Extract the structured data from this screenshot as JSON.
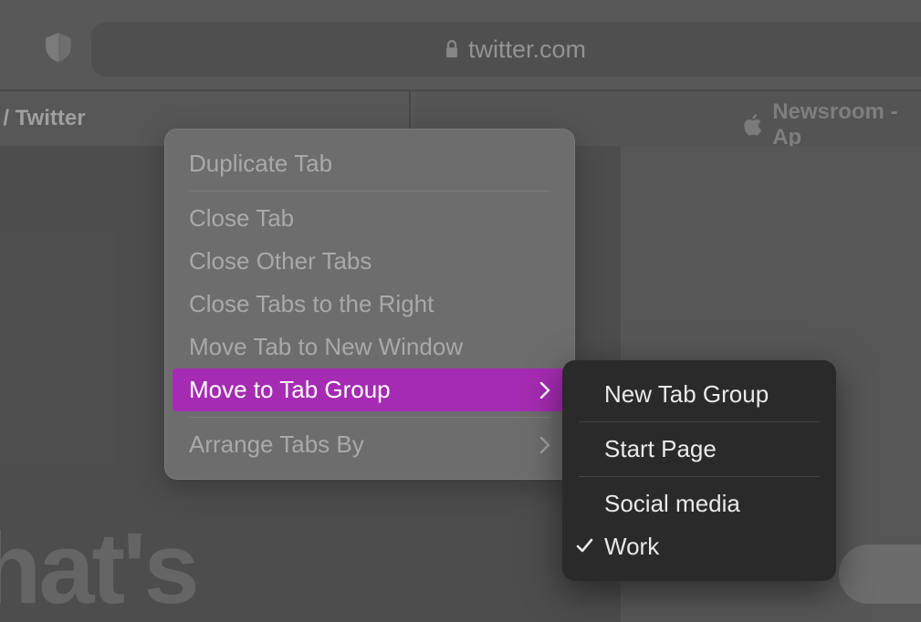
{
  "toolbar": {
    "url_display": "twitter.com"
  },
  "tabs": {
    "left": "appening / Twitter",
    "right": "Newsroom - Ap"
  },
  "page": {
    "big_text": "vhat's"
  },
  "context_menu": {
    "items": [
      {
        "label": "Duplicate Tab",
        "sep_after": true
      },
      {
        "label": "Close Tab"
      },
      {
        "label": "Close Other Tabs"
      },
      {
        "label": "Close Tabs to the Right"
      },
      {
        "label": "Move Tab to New Window"
      },
      {
        "label": "Move to Tab Group",
        "submenu": true,
        "highlighted": true,
        "sep_after": true
      },
      {
        "label": "Arrange Tabs By",
        "submenu": true
      }
    ]
  },
  "submenu": {
    "items": [
      {
        "label": "New Tab Group",
        "sep_after": true
      },
      {
        "label": "Start Page",
        "sep_after": true
      },
      {
        "label": "Social media"
      },
      {
        "label": "Work",
        "checked": true
      }
    ]
  }
}
